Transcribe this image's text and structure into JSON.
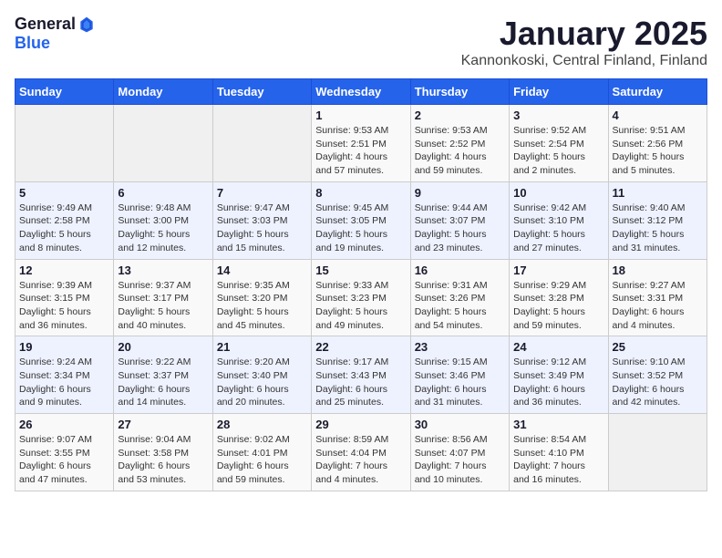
{
  "logo": {
    "general": "General",
    "blue": "Blue"
  },
  "title": "January 2025",
  "subtitle": "Kannonkoski, Central Finland, Finland",
  "weekdays": [
    "Sunday",
    "Monday",
    "Tuesday",
    "Wednesday",
    "Thursday",
    "Friday",
    "Saturday"
  ],
  "weeks": [
    [
      {
        "day": "",
        "info": ""
      },
      {
        "day": "",
        "info": ""
      },
      {
        "day": "",
        "info": ""
      },
      {
        "day": "1",
        "info": "Sunrise: 9:53 AM\nSunset: 2:51 PM\nDaylight: 4 hours\nand 57 minutes."
      },
      {
        "day": "2",
        "info": "Sunrise: 9:53 AM\nSunset: 2:52 PM\nDaylight: 4 hours\nand 59 minutes."
      },
      {
        "day": "3",
        "info": "Sunrise: 9:52 AM\nSunset: 2:54 PM\nDaylight: 5 hours\nand 2 minutes."
      },
      {
        "day": "4",
        "info": "Sunrise: 9:51 AM\nSunset: 2:56 PM\nDaylight: 5 hours\nand 5 minutes."
      }
    ],
    [
      {
        "day": "5",
        "info": "Sunrise: 9:49 AM\nSunset: 2:58 PM\nDaylight: 5 hours\nand 8 minutes."
      },
      {
        "day": "6",
        "info": "Sunrise: 9:48 AM\nSunset: 3:00 PM\nDaylight: 5 hours\nand 12 minutes."
      },
      {
        "day": "7",
        "info": "Sunrise: 9:47 AM\nSunset: 3:03 PM\nDaylight: 5 hours\nand 15 minutes."
      },
      {
        "day": "8",
        "info": "Sunrise: 9:45 AM\nSunset: 3:05 PM\nDaylight: 5 hours\nand 19 minutes."
      },
      {
        "day": "9",
        "info": "Sunrise: 9:44 AM\nSunset: 3:07 PM\nDaylight: 5 hours\nand 23 minutes."
      },
      {
        "day": "10",
        "info": "Sunrise: 9:42 AM\nSunset: 3:10 PM\nDaylight: 5 hours\nand 27 minutes."
      },
      {
        "day": "11",
        "info": "Sunrise: 9:40 AM\nSunset: 3:12 PM\nDaylight: 5 hours\nand 31 minutes."
      }
    ],
    [
      {
        "day": "12",
        "info": "Sunrise: 9:39 AM\nSunset: 3:15 PM\nDaylight: 5 hours\nand 36 minutes."
      },
      {
        "day": "13",
        "info": "Sunrise: 9:37 AM\nSunset: 3:17 PM\nDaylight: 5 hours\nand 40 minutes."
      },
      {
        "day": "14",
        "info": "Sunrise: 9:35 AM\nSunset: 3:20 PM\nDaylight: 5 hours\nand 45 minutes."
      },
      {
        "day": "15",
        "info": "Sunrise: 9:33 AM\nSunset: 3:23 PM\nDaylight: 5 hours\nand 49 minutes."
      },
      {
        "day": "16",
        "info": "Sunrise: 9:31 AM\nSunset: 3:26 PM\nDaylight: 5 hours\nand 54 minutes."
      },
      {
        "day": "17",
        "info": "Sunrise: 9:29 AM\nSunset: 3:28 PM\nDaylight: 5 hours\nand 59 minutes."
      },
      {
        "day": "18",
        "info": "Sunrise: 9:27 AM\nSunset: 3:31 PM\nDaylight: 6 hours\nand 4 minutes."
      }
    ],
    [
      {
        "day": "19",
        "info": "Sunrise: 9:24 AM\nSunset: 3:34 PM\nDaylight: 6 hours\nand 9 minutes."
      },
      {
        "day": "20",
        "info": "Sunrise: 9:22 AM\nSunset: 3:37 PM\nDaylight: 6 hours\nand 14 minutes."
      },
      {
        "day": "21",
        "info": "Sunrise: 9:20 AM\nSunset: 3:40 PM\nDaylight: 6 hours\nand 20 minutes."
      },
      {
        "day": "22",
        "info": "Sunrise: 9:17 AM\nSunset: 3:43 PM\nDaylight: 6 hours\nand 25 minutes."
      },
      {
        "day": "23",
        "info": "Sunrise: 9:15 AM\nSunset: 3:46 PM\nDaylight: 6 hours\nand 31 minutes."
      },
      {
        "day": "24",
        "info": "Sunrise: 9:12 AM\nSunset: 3:49 PM\nDaylight: 6 hours\nand 36 minutes."
      },
      {
        "day": "25",
        "info": "Sunrise: 9:10 AM\nSunset: 3:52 PM\nDaylight: 6 hours\nand 42 minutes."
      }
    ],
    [
      {
        "day": "26",
        "info": "Sunrise: 9:07 AM\nSunset: 3:55 PM\nDaylight: 6 hours\nand 47 minutes."
      },
      {
        "day": "27",
        "info": "Sunrise: 9:04 AM\nSunset: 3:58 PM\nDaylight: 6 hours\nand 53 minutes."
      },
      {
        "day": "28",
        "info": "Sunrise: 9:02 AM\nSunset: 4:01 PM\nDaylight: 6 hours\nand 59 minutes."
      },
      {
        "day": "29",
        "info": "Sunrise: 8:59 AM\nSunset: 4:04 PM\nDaylight: 7 hours\nand 4 minutes."
      },
      {
        "day": "30",
        "info": "Sunrise: 8:56 AM\nSunset: 4:07 PM\nDaylight: 7 hours\nand 10 minutes."
      },
      {
        "day": "31",
        "info": "Sunrise: 8:54 AM\nSunset: 4:10 PM\nDaylight: 7 hours\nand 16 minutes."
      },
      {
        "day": "",
        "info": ""
      }
    ]
  ]
}
